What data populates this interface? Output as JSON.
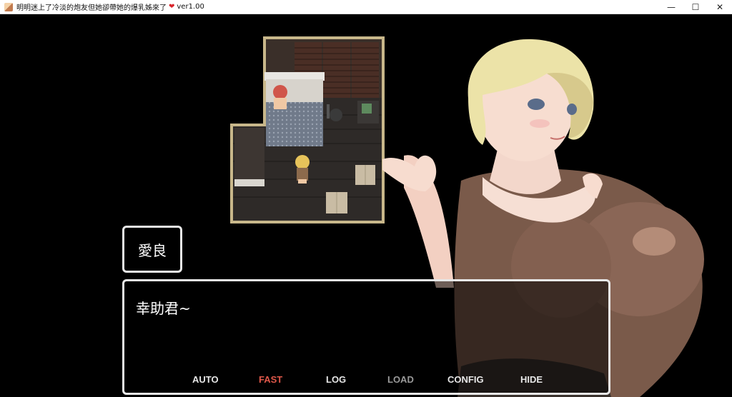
{
  "window": {
    "title": "明明迷上了冷淡的炮友但她卻帶她的爆乳姊來了",
    "version": "ver1.00",
    "minimize": "—",
    "maximize": "☐",
    "close": "✕"
  },
  "dialog": {
    "speaker": "愛良",
    "message": "幸助君~"
  },
  "menu": {
    "auto": "AUTO",
    "fast": "FAST",
    "log": "LOG",
    "load": "LOAD",
    "config": "CONFIG",
    "hide": "HIDE"
  },
  "colors": {
    "active_menu": "#e0584a",
    "frame": "#e9e9e9"
  }
}
